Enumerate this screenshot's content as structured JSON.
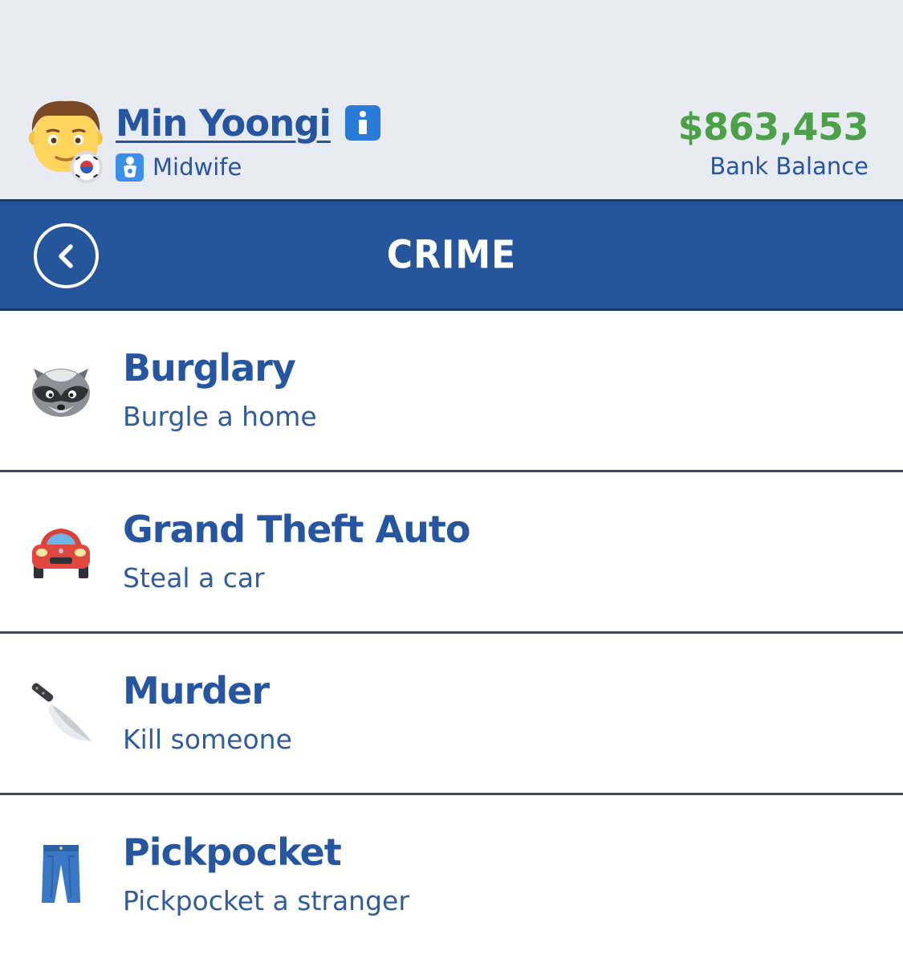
{
  "player": {
    "name": "Min Yoongi",
    "job": "Midwife",
    "avatar_icon": "man-face-icon",
    "flag_icon": "south-korea-flag-icon"
  },
  "bank": {
    "balance": "$863,453",
    "label": "Bank Balance"
  },
  "screen": {
    "title": "CRIME"
  },
  "crimes": [
    {
      "title": "Burglary",
      "description": "Burgle a home",
      "icon": "raccoon-icon"
    },
    {
      "title": "Grand Theft Auto",
      "description": "Steal a car",
      "icon": "red-car-icon"
    },
    {
      "title": "Murder",
      "description": "Kill someone",
      "icon": "kitchen-knife-icon"
    },
    {
      "title": "Pickpocket",
      "description": "Pickpocket a stranger",
      "icon": "jeans-icon"
    }
  ],
  "colors": {
    "header_bg": "#e8ebf1",
    "title_bar": "#25559a",
    "text_blue": "#2656a0",
    "money_green": "#4ca148"
  }
}
